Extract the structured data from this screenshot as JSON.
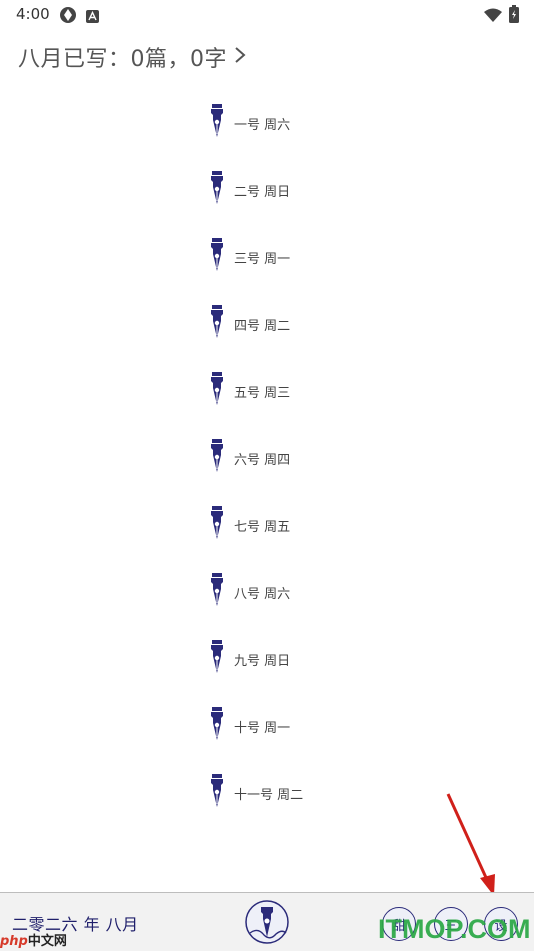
{
  "status_bar": {
    "time": "4:00"
  },
  "header": {
    "summary": "八月已写：0篇，0字"
  },
  "entries": [
    {
      "label": "一号 周六"
    },
    {
      "label": "二号 周日"
    },
    {
      "label": "三号 周一"
    },
    {
      "label": "四号 周二"
    },
    {
      "label": "五号 周三"
    },
    {
      "label": "六号 周四"
    },
    {
      "label": "七号 周五"
    },
    {
      "label": "八号 周六"
    },
    {
      "label": "九号 周日"
    },
    {
      "label": "十号 周一"
    },
    {
      "label": "十一号 周二"
    }
  ],
  "bottom_bar": {
    "year_month": "二零二六 年 八月",
    "buttons": [
      {
        "label": "甜"
      },
      {
        "label": "三"
      },
      {
        "label": "设"
      }
    ]
  },
  "watermarks": {
    "php": "php",
    "cn": "中文网",
    "itmop": "ITMOP.COM"
  },
  "colors": {
    "accent": "#2b2b7a",
    "arrow": "#d0201a",
    "itmop": "#2aa845"
  }
}
